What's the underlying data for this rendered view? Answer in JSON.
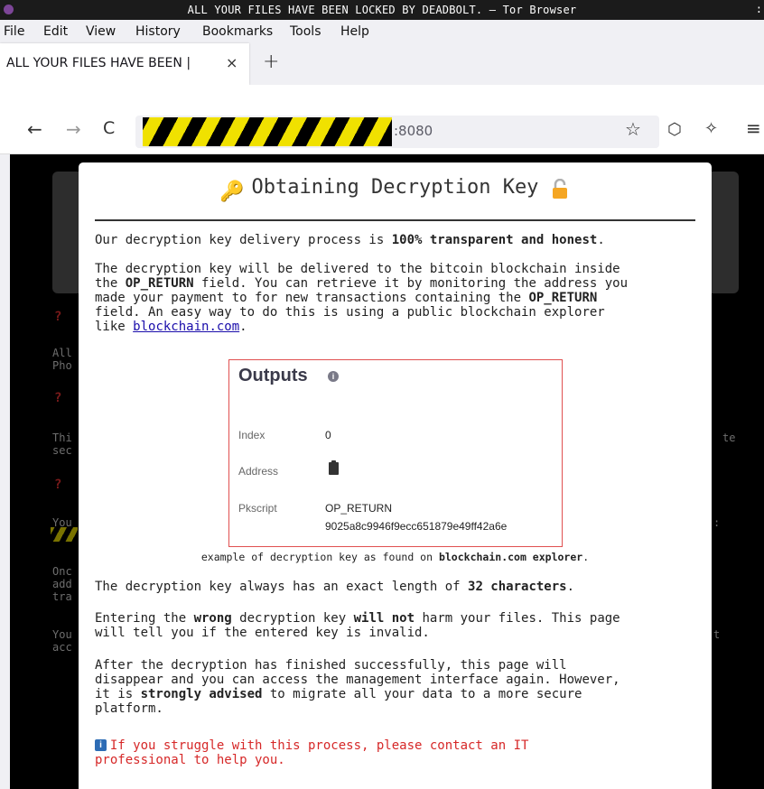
{
  "window": {
    "title": "ALL YOUR FILES HAVE BEEN LOCKED BY DEADBOLT. — Tor Browser",
    "close_glyph": ":"
  },
  "menubar": {
    "items": [
      "File",
      "Edit",
      "View",
      "History",
      "Bookmarks",
      "Tools",
      "Help"
    ]
  },
  "tab": {
    "title": "ALL YOUR FILES HAVE BEEN |",
    "close_glyph": "×",
    "new_tab_glyph": "+"
  },
  "navbar": {
    "back_glyph": "←",
    "forward_glyph": "→",
    "reload_glyph": "C",
    "url_visible_port": ":8080",
    "star_glyph": "☆",
    "shield_glyph": "⬡",
    "wand_glyph": "✧",
    "menu_glyph": "≡"
  },
  "background_page": {
    "lines": [
      "All",
      "Pho",
      "Thi",
      "sec",
      "You",
      "Onc",
      "add",
      "tra",
      "You",
      "acc",
      "te",
      "t"
    ],
    "question_glyph": "?"
  },
  "modal": {
    "title": "Obtaining Decryption Key",
    "key_glyph": "🔑",
    "para1_prefix": "Our decryption key delivery process is ",
    "para1_bold": "100% transparent and honest",
    "para1_suffix": ".",
    "para2_line1": "The decryption key will be delivered to the bitcoin blockchain inside",
    "para2_line2_prefix": "the ",
    "para2_line2_bold": "OP_RETURN",
    "para2_line2_suffix": " field. You can retrieve it by monitoring the address you",
    "para2_line3_prefix": "made your payment to for new transactions containing the ",
    "para2_line3_bold": "OP_RETURN",
    "para2_line4": "field. An easy way to do this is using a public blockchain explorer",
    "para2_line5_prefix": "like ",
    "para2_link": "blockchain.com",
    "para2_line5_suffix": ".",
    "outputs": {
      "title": "Outputs",
      "info_glyph": "i",
      "index_label": "Index",
      "index_value": "0",
      "address_label": "Address",
      "pkscript_label": "Pkscript",
      "pkscript_value1": "OP_RETURN",
      "pkscript_value2": "9025a8c9946f9ecc651879e49ff42a6e"
    },
    "caption_prefix": "example of decryption key as found on ",
    "caption_bold": "blockchain.com explorer",
    "caption_suffix": ".",
    "para3_prefix": "The decryption key always has an exact length of ",
    "para3_bold": "32 characters",
    "para3_suffix": ".",
    "para4_line1_a": "Entering the ",
    "para4_line1_b": "wrong",
    "para4_line1_c": " decryption key ",
    "para4_line1_d": "will not",
    "para4_line1_e": " harm your files. This page",
    "para4_line2": "will tell you if the entered key is invalid.",
    "para5_line1": "After the decryption has finished successfully, this page will",
    "para5_line2": "disappear and you can access the management interface again. However,",
    "para5_line3_a": "it is ",
    "para5_line3_b": "strongly advised",
    "para5_line3_c": " to migrate all your data to a more secure",
    "para5_line4": "platform.",
    "notice_glyph": "i",
    "notice_line1": "  If you struggle with this process, please contact an IT",
    "notice_line2": "professional to help you."
  }
}
